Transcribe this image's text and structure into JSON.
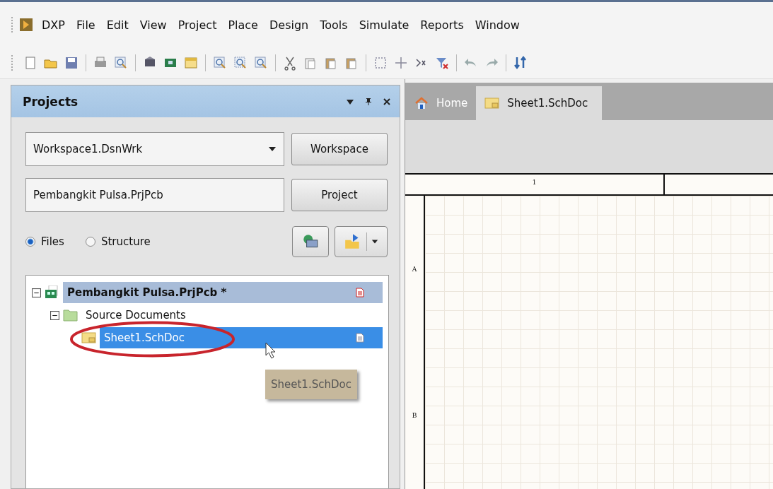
{
  "menu": [
    {
      "label": "DXP"
    },
    {
      "label": "File"
    },
    {
      "label": "Edit"
    },
    {
      "label": "View"
    },
    {
      "label": "Project"
    },
    {
      "label": "Place"
    },
    {
      "label": "Design"
    },
    {
      "label": "Tools"
    },
    {
      "label": "Simulate"
    },
    {
      "label": "Reports"
    },
    {
      "label": "Window"
    }
  ],
  "panel": {
    "title": "Projects",
    "workspace_field": {
      "value": "Workspace1.DsnWrk"
    },
    "workspace_button": "Workspace",
    "project_field": {
      "value": "Pembangkit Pulsa.PrjPcb"
    },
    "project_button": "Project",
    "view_options": [
      {
        "label": "Files",
        "selected": true
      },
      {
        "label": "Structure",
        "selected": false
      }
    ],
    "tree": [
      {
        "label": "Pembangkit Pulsa.PrjPcb *",
        "kind": "project",
        "expanded": true,
        "selected": false,
        "children": [
          {
            "label": "Source Documents",
            "kind": "folder",
            "expanded": true,
            "selected": false,
            "children": [
              {
                "label": "Sheet1.SchDoc",
                "kind": "schematic",
                "selected": true
              }
            ]
          }
        ]
      }
    ],
    "tooltip": "Sheet1.SchDoc"
  },
  "tabs": [
    {
      "label": "Home",
      "kind": "home",
      "selected": false
    },
    {
      "label": "Sheet1.SchDoc",
      "kind": "schematic",
      "selected": true
    }
  ],
  "sheet": {
    "column_labels": [
      "1"
    ],
    "row_labels": [
      "A",
      "B"
    ]
  }
}
